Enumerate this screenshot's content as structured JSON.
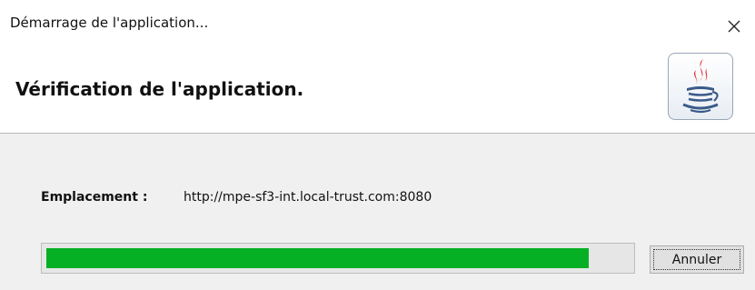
{
  "window": {
    "title": "Démarrage de l'application..."
  },
  "header": {
    "title": "Vérification de l'application.",
    "logo_icon": "java-coffee-cup-icon"
  },
  "content": {
    "location_label": "Emplacement :",
    "location_url": "http://mpe-sf3-int.local-trust.com:8080",
    "progress_fraction": 0.93,
    "progress_color": "#06b025",
    "cancel_label": "Annuler"
  }
}
